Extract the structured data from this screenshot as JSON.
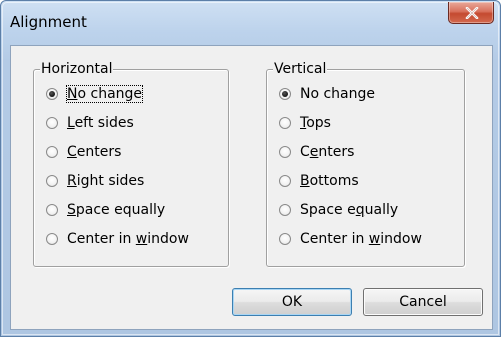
{
  "window": {
    "title": "Alignment"
  },
  "horizontal": {
    "label": "Horizontal",
    "options": [
      {
        "pre": "",
        "key": "N",
        "post": "o change",
        "selected": true
      },
      {
        "pre": "",
        "key": "L",
        "post": "eft sides",
        "selected": false
      },
      {
        "pre": "",
        "key": "C",
        "post": "enters",
        "selected": false
      },
      {
        "pre": "",
        "key": "R",
        "post": "ight sides",
        "selected": false
      },
      {
        "pre": "",
        "key": "S",
        "post": "pace equally",
        "selected": false
      },
      {
        "pre": "Center in ",
        "key": "w",
        "post": "indow",
        "selected": false
      }
    ]
  },
  "vertical": {
    "label": "Vertical",
    "options": [
      {
        "pre": "No change",
        "key": "",
        "post": "",
        "selected": true
      },
      {
        "pre": "",
        "key": "T",
        "post": "ops",
        "selected": false
      },
      {
        "pre": "C",
        "key": "e",
        "post": "nters",
        "selected": false
      },
      {
        "pre": "",
        "key": "B",
        "post": "ottoms",
        "selected": false
      },
      {
        "pre": "Space e",
        "key": "q",
        "post": "ually",
        "selected": false
      },
      {
        "pre": "Center in ",
        "key": "w",
        "post": "indow",
        "selected": false
      }
    ]
  },
  "buttons": {
    "ok": "OK",
    "cancel": "Cancel"
  }
}
